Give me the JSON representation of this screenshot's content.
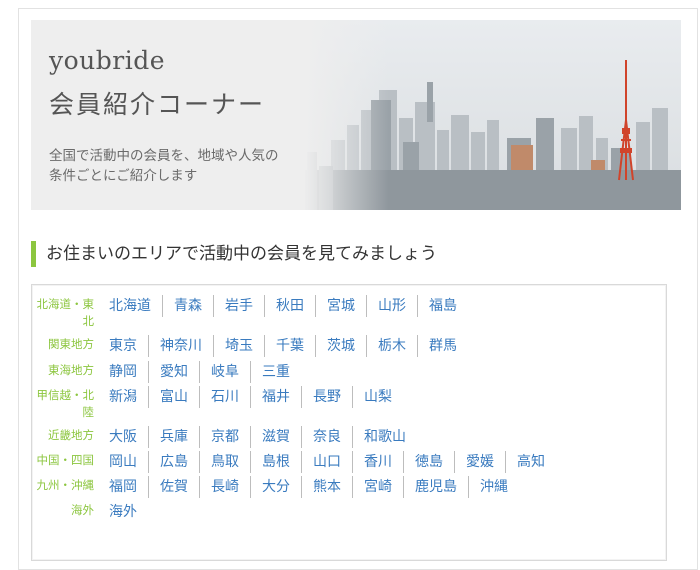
{
  "banner": {
    "brand": "youbride",
    "subtitle": "会員紹介コーナー",
    "desc_line1": "全国で活動中の会員を、地域や人気の",
    "desc_line2": "条件ごとにご紹介します"
  },
  "section_title": "お住まいのエリアで活動中の会員を見てみましょう",
  "regions": [
    {
      "label": "北海道・東北",
      "prefs": [
        "北海道",
        "青森",
        "岩手",
        "秋田",
        "宮城",
        "山形",
        "福島"
      ]
    },
    {
      "label": "関東地方",
      "prefs": [
        "東京",
        "神奈川",
        "埼玉",
        "千葉",
        "茨城",
        "栃木",
        "群馬"
      ]
    },
    {
      "label": "東海地方",
      "prefs": [
        "静岡",
        "愛知",
        "岐阜",
        "三重"
      ]
    },
    {
      "label": "甲信越・北陸",
      "prefs": [
        "新潟",
        "富山",
        "石川",
        "福井",
        "長野",
        "山梨"
      ]
    },
    {
      "label": "近畿地方",
      "prefs": [
        "大阪",
        "兵庫",
        "京都",
        "滋賀",
        "奈良",
        "和歌山"
      ]
    },
    {
      "label": "中国・四国",
      "prefs": [
        "岡山",
        "広島",
        "鳥取",
        "島根",
        "山口",
        "香川",
        "徳島",
        "愛媛",
        "高知"
      ]
    },
    {
      "label": "九州・沖縄",
      "prefs": [
        "福岡",
        "佐賀",
        "長崎",
        "大分",
        "熊本",
        "宮崎",
        "鹿児島",
        "沖縄"
      ]
    },
    {
      "label": "海外",
      "prefs": [
        "海外"
      ]
    }
  ],
  "colors": {
    "accent": "#8cc63f",
    "link": "#3a7bbf"
  }
}
